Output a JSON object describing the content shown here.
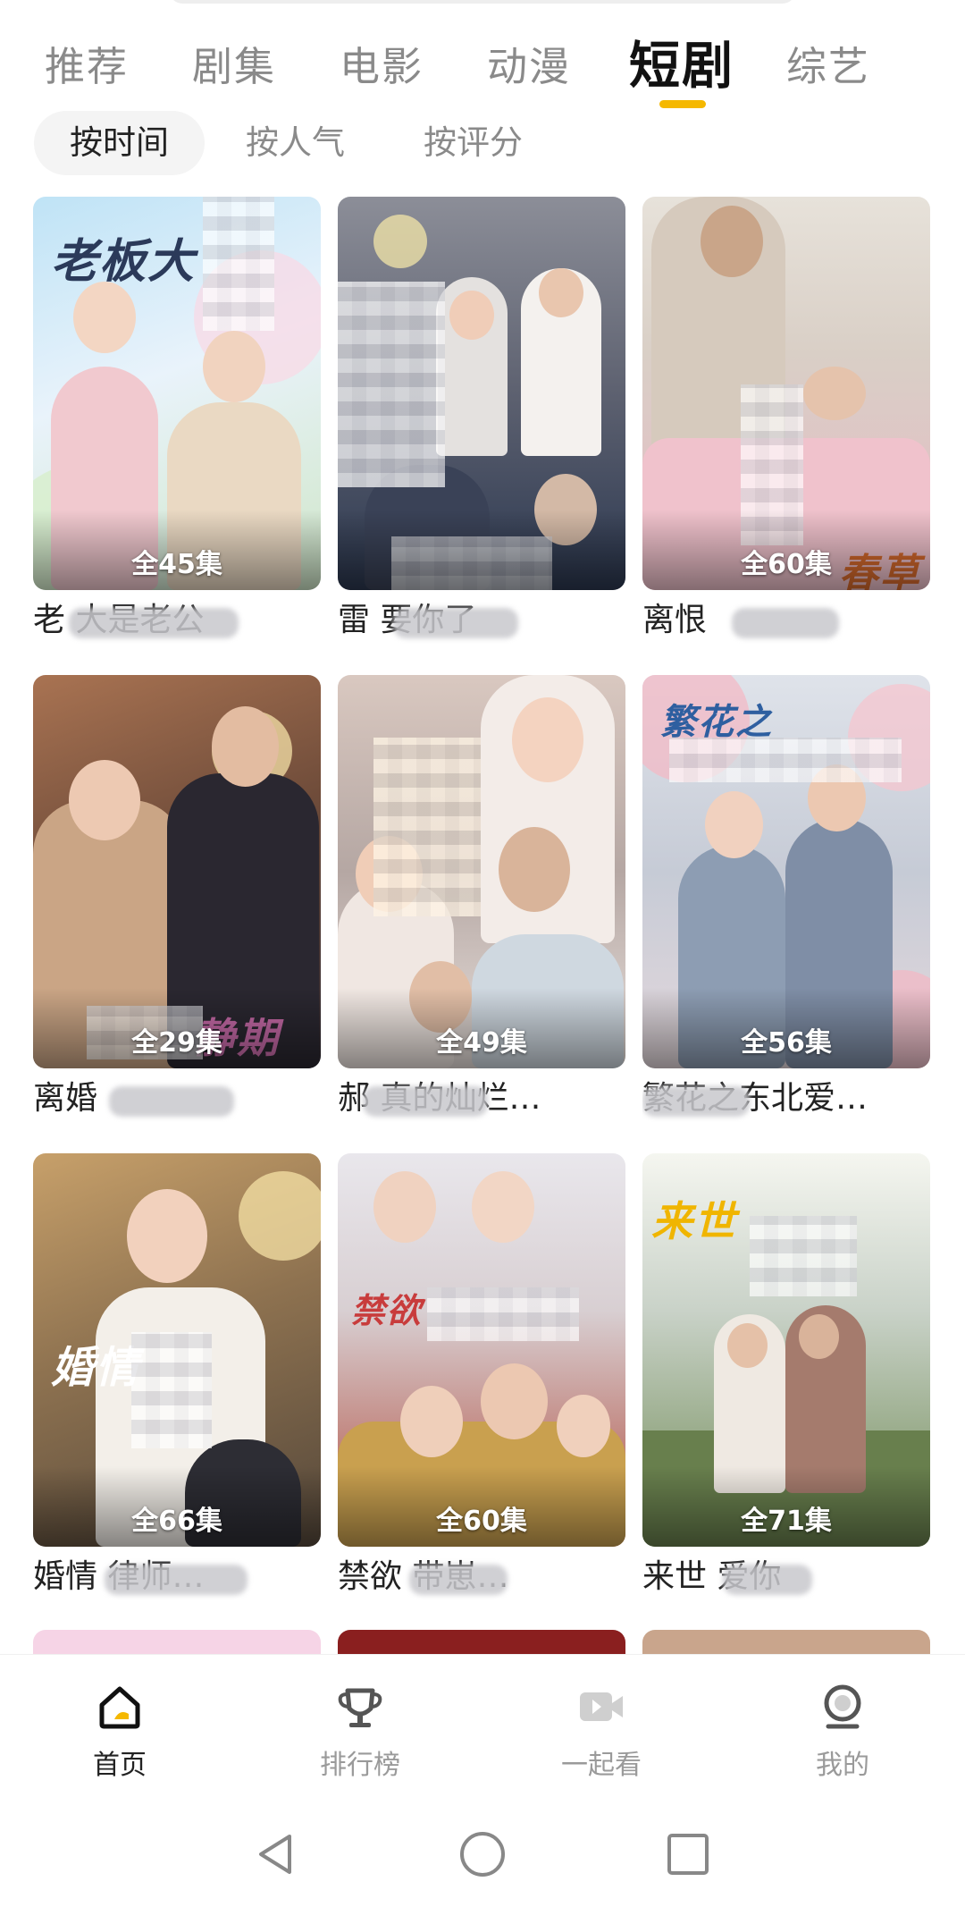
{
  "categories": [
    {
      "label": "推荐",
      "active": false
    },
    {
      "label": "剧集",
      "active": false
    },
    {
      "label": "电影",
      "active": false
    },
    {
      "label": "动漫",
      "active": false
    },
    {
      "label": "短剧",
      "active": true
    },
    {
      "label": "综艺",
      "active": false
    }
  ],
  "sort": [
    {
      "label": "按时间",
      "active": true
    },
    {
      "label": "按人气",
      "active": false
    },
    {
      "label": "按评分",
      "active": false
    }
  ],
  "cards": [
    {
      "title": "老 大是老公",
      "episodes": "全45集",
      "art": "老板大"
    },
    {
      "title": "雷 要你了",
      "episodes": "",
      "art": ""
    },
    {
      "title": "离恨 ",
      "episodes": "全60集",
      "art": "春草"
    },
    {
      "title": "离婚 ",
      "episodes": "全29集",
      "art": "静期"
    },
    {
      "title": "郝 真的灿烂…",
      "episodes": "全49集",
      "art": ""
    },
    {
      "title": "繁花之东北爱…",
      "episodes": "全56集",
      "art": "繁花之"
    },
    {
      "title": "婚情 律师…",
      "episodes": "全66集",
      "art": "婚情"
    },
    {
      "title": "禁欲 带崽…",
      "episodes": "全60集",
      "art": "禁欲"
    },
    {
      "title": "来世 爱你",
      "episodes": "全71集",
      "art": "来世"
    }
  ],
  "colors": {
    "accent": "#f5b800",
    "inactive": "#8a8a8a",
    "active_text": "#111111"
  },
  "nav": [
    {
      "label": "首页",
      "icon": "home-icon",
      "active": true
    },
    {
      "label": "排行榜",
      "icon": "trophy-icon",
      "active": false
    },
    {
      "label": "一起看",
      "icon": "video-icon",
      "active": false
    },
    {
      "label": "我的",
      "icon": "profile-icon",
      "active": false
    }
  ]
}
